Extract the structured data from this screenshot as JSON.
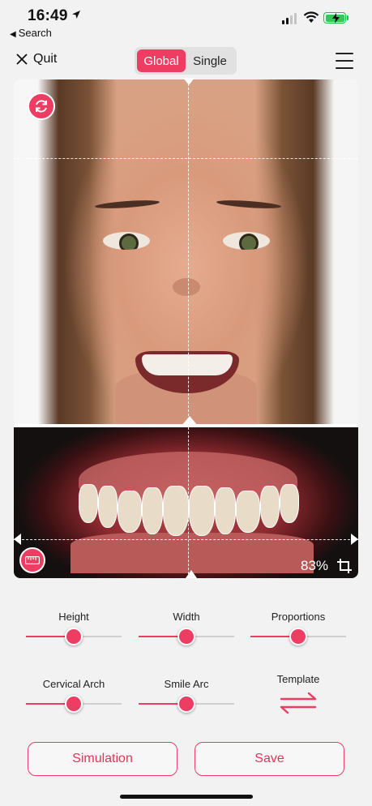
{
  "status_bar": {
    "time": "16:49",
    "back_app": "Search",
    "battery_color": "#34c759"
  },
  "nav": {
    "quit_label": "Quit",
    "segments": [
      {
        "label": "Global",
        "active": true
      },
      {
        "label": "Single",
        "active": false
      }
    ],
    "menu_icon": "hamburger-menu-icon"
  },
  "canvas": {
    "rotate_icon": "rotate-cycle-icon",
    "ruler_icon": "ruler-icon",
    "zoom": "83%",
    "crop_icon": "crop-icon"
  },
  "controls": {
    "sliders": [
      {
        "label": "Height",
        "value": 0.5
      },
      {
        "label": "Width",
        "value": 0.5
      },
      {
        "label": "Proportions",
        "value": 0.5
      },
      {
        "label": "Cervical Arch",
        "value": 0.5
      },
      {
        "label": "Smile Arc",
        "value": 0.5
      }
    ],
    "template_label": "Template",
    "template_icon": "swap-arrows-icon"
  },
  "actions": {
    "simulation_label": "Simulation",
    "save_label": "Save"
  },
  "accent_color": "#ee3d62"
}
